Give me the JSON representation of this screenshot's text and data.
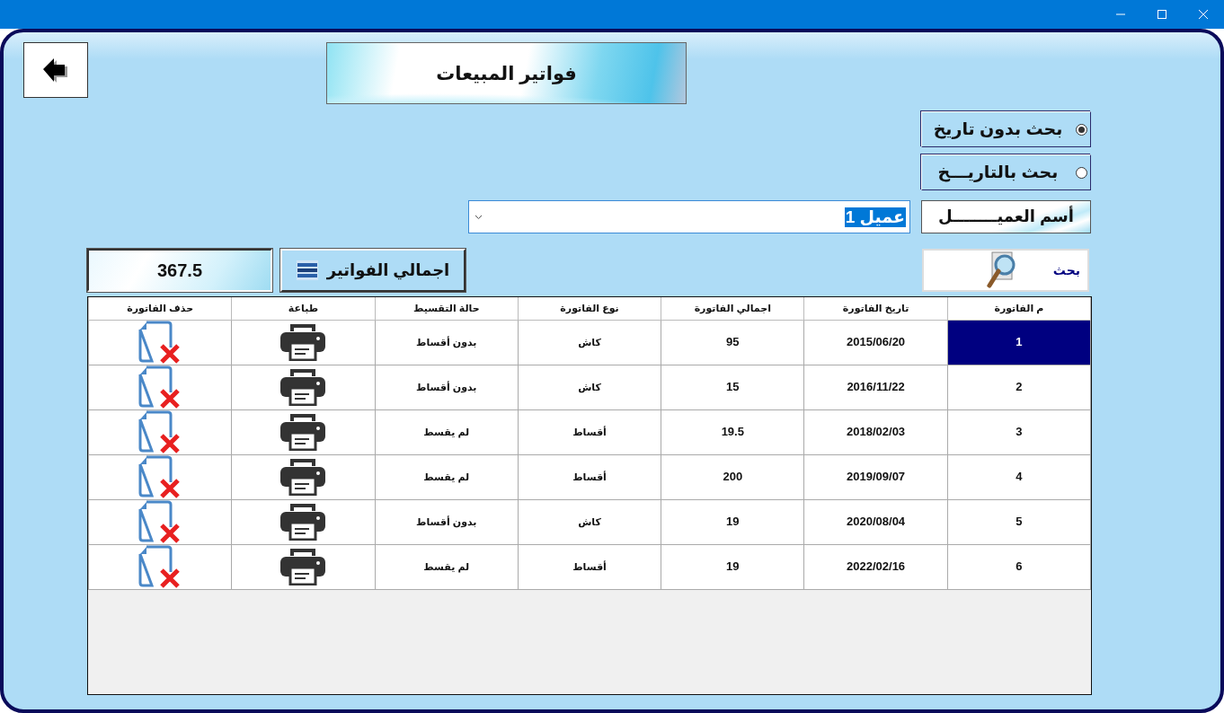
{
  "title": "فواتير المبيعات",
  "search_modes": [
    {
      "label": "بحث بدون تاريخ",
      "selected": true
    },
    {
      "label": "بحث بالتاريـــخ",
      "selected": false
    }
  ],
  "customer": {
    "label": "أسم العميــــــــل",
    "value": "عميل 1"
  },
  "search_button": {
    "label": "بحث"
  },
  "totals": {
    "label": "اجمالي الفواتير",
    "value": "367.5"
  },
  "table": {
    "columns": [
      "م الفاتورة",
      "تاريخ الفاتورة",
      "اجمالي الفاتورة",
      "نوع الفاتورة",
      "حالة التقسيط",
      "طباعة",
      "حذف الفاتورة"
    ],
    "rows": [
      {
        "cells": [
          "1",
          "2015/06/20",
          "95",
          "كاش",
          "بدون أقساط"
        ],
        "selected": true
      },
      {
        "cells": [
          "2",
          "2016/11/22",
          "15",
          "كاش",
          "بدون أقساط"
        ],
        "selected": false
      },
      {
        "cells": [
          "3",
          "2018/02/03",
          "19.5",
          "أقساط",
          "لم يقسط"
        ],
        "selected": false
      },
      {
        "cells": [
          "4",
          "2019/09/07",
          "200",
          "أقساط",
          "لم يقسط"
        ],
        "selected": false
      },
      {
        "cells": [
          "5",
          "2020/08/04",
          "19",
          "كاش",
          "بدون أقساط"
        ],
        "selected": false
      },
      {
        "cells": [
          "6",
          "2022/02/16",
          "19",
          "أقساط",
          "لم يقسط"
        ],
        "selected": false
      }
    ]
  }
}
